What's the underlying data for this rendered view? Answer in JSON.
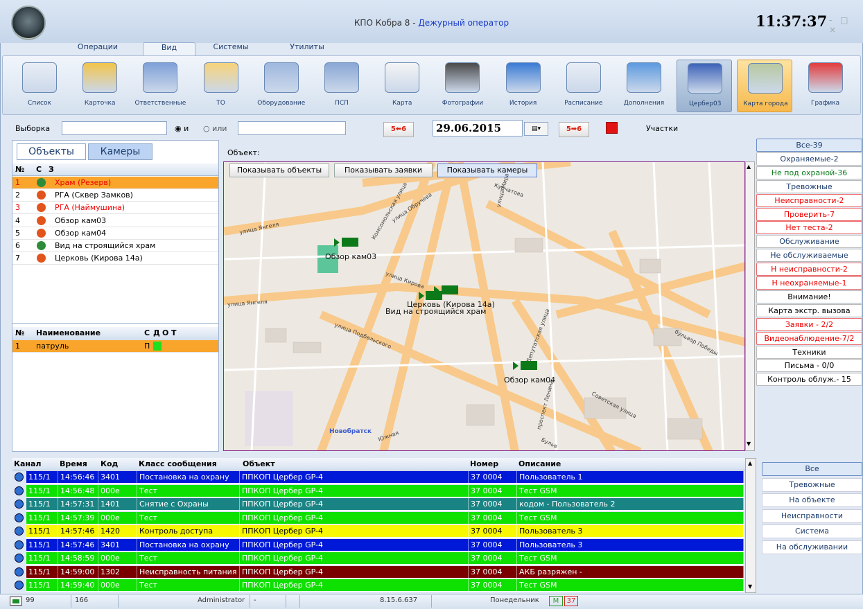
{
  "window": {
    "title": "КПО Кобра 8 - ",
    "role": "Дежурный оператор",
    "clock": "11:37:37",
    "controls": "- □ ×"
  },
  "menu": {
    "tabs": [
      "Операции",
      "Вид",
      "Системы",
      "Утилиты"
    ]
  },
  "ribbon": {
    "buttons": [
      "Список",
      "Карточка",
      "Ответственные",
      "ТО",
      "Оборудование",
      "ПСП",
      "Карта",
      "Фотографии",
      "История",
      "Расписание",
      "Дополнения",
      "Цербер03",
      "Карта города",
      "Графика"
    ]
  },
  "filter": {
    "label": "Выборка",
    "opt_and": "и",
    "opt_or": "или",
    "date": "29.06.2015",
    "btn1": "5⬅6",
    "btn2": "5➡6",
    "sections": "Участки"
  },
  "left": {
    "tab_objects": "Объекты",
    "tab_cameras": "Камеры",
    "columns": [
      "№",
      "С",
      "З"
    ],
    "rows": [
      {
        "n": "1",
        "name": "Храм (Резерв)",
        "ok": true
      },
      {
        "n": "2",
        "name": "РГА (Сквер Замков)",
        "ok": false
      },
      {
        "n": "3",
        "name": "РГА (Наймушина)",
        "ok": false
      },
      {
        "n": "4",
        "name": "Обзор кам03",
        "ok": false
      },
      {
        "n": "5",
        "name": "Обзор кам04",
        "ok": false
      },
      {
        "n": "6",
        "name": "Вид на строящийся храм",
        "ok": true
      },
      {
        "n": "7",
        "name": "Церковь (Кирова 14а)",
        "ok": false
      }
    ],
    "patrol_columns": [
      "№",
      "Наименование",
      "С",
      "Д",
      "О",
      "Т"
    ],
    "patrol_row": {
      "n": "1",
      "name": "патруль",
      "d": "П"
    }
  },
  "map": {
    "object_label": "Объект:",
    "btn_objects": "Показывать объекты",
    "btn_requests": "Показывать заявки",
    "btn_cameras": "Показывать камеры",
    "cam_labels": [
      "Обзор кам03",
      "Церковь (Кирова 14а)",
      "Вид на строящийся храм",
      "Обзор кам04"
    ],
    "streets": [
      "улица Янгеля",
      "Комсомольская улица",
      "улица Обручева",
      "улица Мира",
      "Курчатова",
      "улица Кирова",
      "улица Подбельского",
      "Депутатская улица",
      "бульвар Победы",
      "Советская улица",
      "проспект Ленина",
      "Новобратск",
      "Южная",
      "улица Янгеля",
      "Бульв"
    ]
  },
  "right": [
    {
      "t": "Все-39",
      "c": "blu"
    },
    {
      "t": "Охраняемые-2",
      "c": "blu"
    },
    {
      "t": "Не под охраной-36",
      "c": "grn"
    },
    {
      "t": "Тревожные",
      "c": "blu"
    },
    {
      "t": "Неисправности-2",
      "c": "red"
    },
    {
      "t": "Проверить-7",
      "c": "red"
    },
    {
      "t": "Нет теста-2",
      "c": "red"
    },
    {
      "t": "Обслуживание",
      "c": "blu"
    },
    {
      "t": "Не обслуживаемые",
      "c": "blu"
    },
    {
      "t": "Н неисправности-2",
      "c": "red"
    },
    {
      "t": "Н неохраняемые-1",
      "c": "red"
    },
    {
      "t": "Внимание!",
      "c": ""
    },
    {
      "t": "Карта экстр. вызова",
      "c": ""
    },
    {
      "t": "Заявки - 2/2",
      "c": "red"
    },
    {
      "t": "Видеонаблюдение-7/2",
      "c": "red"
    },
    {
      "t": "Техники",
      "c": ""
    },
    {
      "t": "Письма - 0/0",
      "c": ""
    },
    {
      "t": "Контроль облуж.- 15",
      "c": ""
    }
  ],
  "events": {
    "columns": [
      "Канал",
      "Время",
      "Код",
      "Класс сообщения",
      "Объект",
      "Номер",
      "Описание"
    ],
    "rows": [
      {
        "ch": "115/1",
        "t": "14:56:46",
        "code": "3401",
        "cls": "Постановка на охрану",
        "obj": "ППКОП Цербер GP-4",
        "num": "37 0004",
        "desc": "Пользователь 1",
        "bg": "#0018d8",
        "fg": "#fff"
      },
      {
        "ch": "115/1",
        "t": "14:56:48",
        "code": "000e",
        "cls": "Тест",
        "obj": "ППКОП Цербер GP-4",
        "num": "37 0004",
        "desc": "Тест GSM",
        "bg": "#0ee000",
        "fg": "#fff"
      },
      {
        "ch": "115/1",
        "t": "14:57:31",
        "code": "1401",
        "cls": "Снятие с Охраны",
        "obj": "ППКОП Цербер GP-4",
        "num": "37 0004",
        "desc": "кодом - Пользователь 2",
        "bg": "#1a8484",
        "fg": "#fff"
      },
      {
        "ch": "115/1",
        "t": "14:57:39",
        "code": "000e",
        "cls": "Тест",
        "obj": "ППКОП Цербер GP-4",
        "num": "37 0004",
        "desc": "Тест GSM",
        "bg": "#0ee000",
        "fg": "#fff"
      },
      {
        "ch": "115/1",
        "t": "14:57:46",
        "code": "1420",
        "cls": "Контроль доступа",
        "obj": "ППКОП Цербер GP-4",
        "num": "37 0004",
        "desc": "Пользователь 3",
        "bg": "#f8f800",
        "fg": "#000"
      },
      {
        "ch": "115/1",
        "t": "14:57:46",
        "code": "3401",
        "cls": "Постановка на охрану",
        "obj": "ППКОП Цербер GP-4",
        "num": "37 0004",
        "desc": "Пользователь 3",
        "bg": "#0018d8",
        "fg": "#fff"
      },
      {
        "ch": "115/1",
        "t": "14:58:59",
        "code": "000e",
        "cls": "Тест",
        "obj": "ППКОП Цербер GP-4",
        "num": "37 0004",
        "desc": "Тест GSM",
        "bg": "#0ee000",
        "fg": "#fff"
      },
      {
        "ch": "115/1",
        "t": "14:59:00",
        "code": "1302",
        "cls": "Неисправность питания",
        "obj": "ППКОП Цербер GP-4",
        "num": "37 0004",
        "desc": "АКБ разряжен -",
        "bg": "#7a0000",
        "fg": "#fff"
      },
      {
        "ch": "115/1",
        "t": "14:59:40",
        "code": "000e",
        "cls": "Тест",
        "obj": "ППКОП Цербер GP-4",
        "num": "37 0004",
        "desc": "Тест GSM",
        "bg": "#0ee000",
        "fg": "#fff"
      }
    ]
  },
  "filters": [
    "Все",
    "Тревожные",
    "На объекте",
    "Неисправности",
    "Система",
    "На обслуживании"
  ],
  "status": {
    "a": "99",
    "b": "166",
    "user": "Administrator",
    "dash": "-",
    "ver": "8.15.6.637",
    "day": "Понедельник",
    "m": "M",
    "n": "37"
  }
}
